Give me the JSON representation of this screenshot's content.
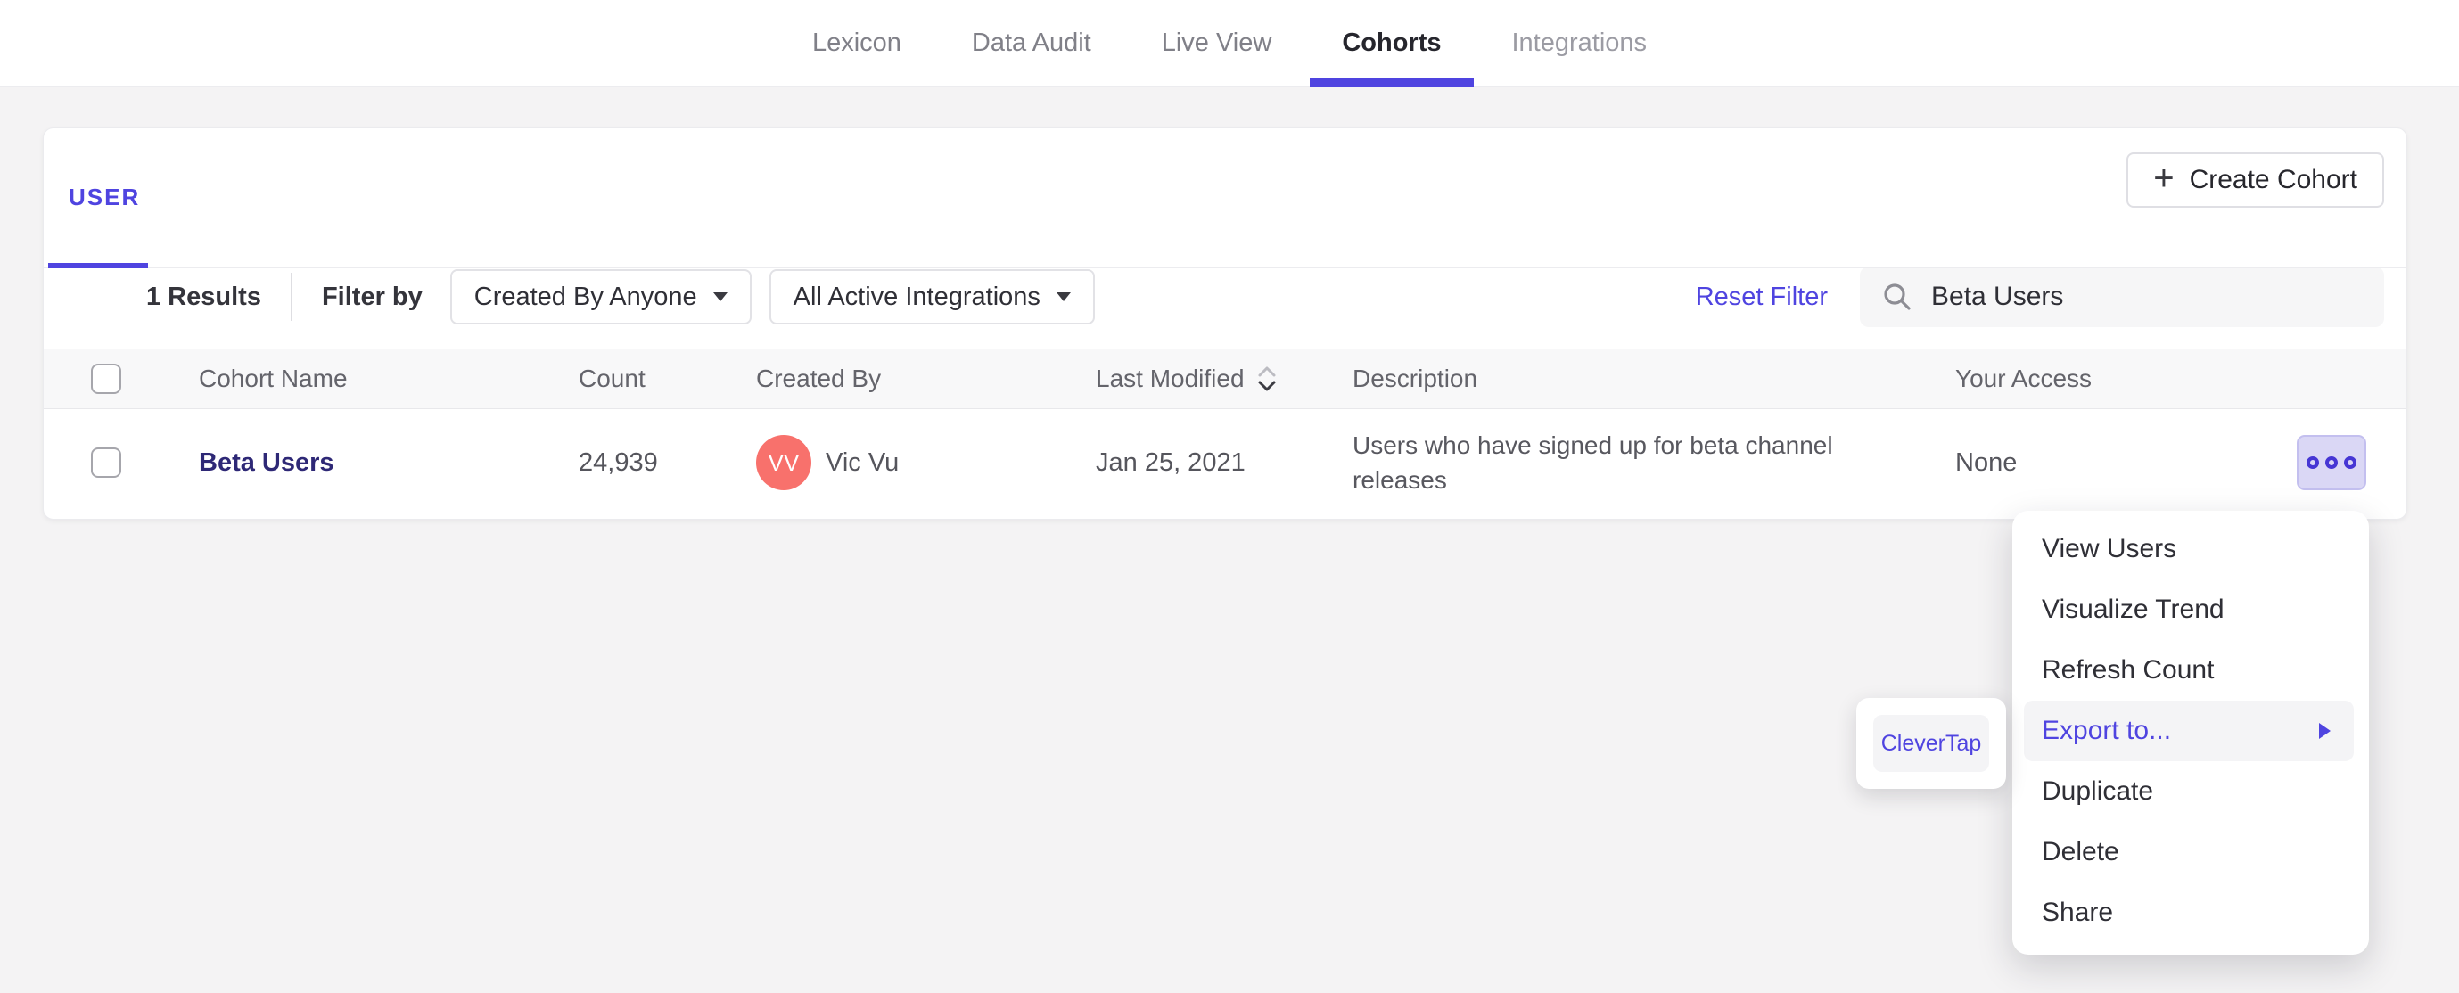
{
  "nav": {
    "items": [
      {
        "label": "Lexicon",
        "active": false
      },
      {
        "label": "Data Audit",
        "active": false
      },
      {
        "label": "Live View",
        "active": false
      },
      {
        "label": "Cohorts",
        "active": true
      },
      {
        "label": "Integrations",
        "active": false
      }
    ]
  },
  "page": {
    "tab_label": "USER",
    "create_button_label": "Create Cohort"
  },
  "filter": {
    "results": "1 Results",
    "filter_by": "Filter by",
    "created_by_dropdown": "Created By Anyone",
    "integrations_dropdown": "All Active Integrations",
    "reset": "Reset Filter",
    "search_value": "Beta Users"
  },
  "table": {
    "headers": [
      "Cohort Name",
      "Count",
      "Created By",
      "Last Modified",
      "Description",
      "Your Access"
    ],
    "rows": [
      {
        "name": "Beta Users",
        "count": "24,939",
        "avatar_initials": "VV",
        "created_by": "Vic Vu",
        "last_modified": "Jan 25, 2021",
        "description": "Users who have signed up for beta channel releases",
        "access": "None"
      }
    ]
  },
  "menu": {
    "items": [
      "View Users",
      "Visualize Trend",
      "Refresh Count",
      "Export to...",
      "Duplicate",
      "Delete",
      "Share"
    ],
    "highlighted_item": "Export to...",
    "submenu_items": [
      "CleverTap"
    ]
  },
  "icons": {
    "plus": "+",
    "search": "magnifier",
    "sort": "double-chevron-up-down",
    "caret": "caret-down",
    "more_options": "three-dots",
    "submenu_arrow": "right-triangle"
  },
  "colors": {
    "accent": "#4F44E0",
    "avatar": "#F8716C",
    "cohort_link": "#2E2876",
    "more_button_bg": "#DAD7F5",
    "page_bg": "#F4F3F4"
  }
}
